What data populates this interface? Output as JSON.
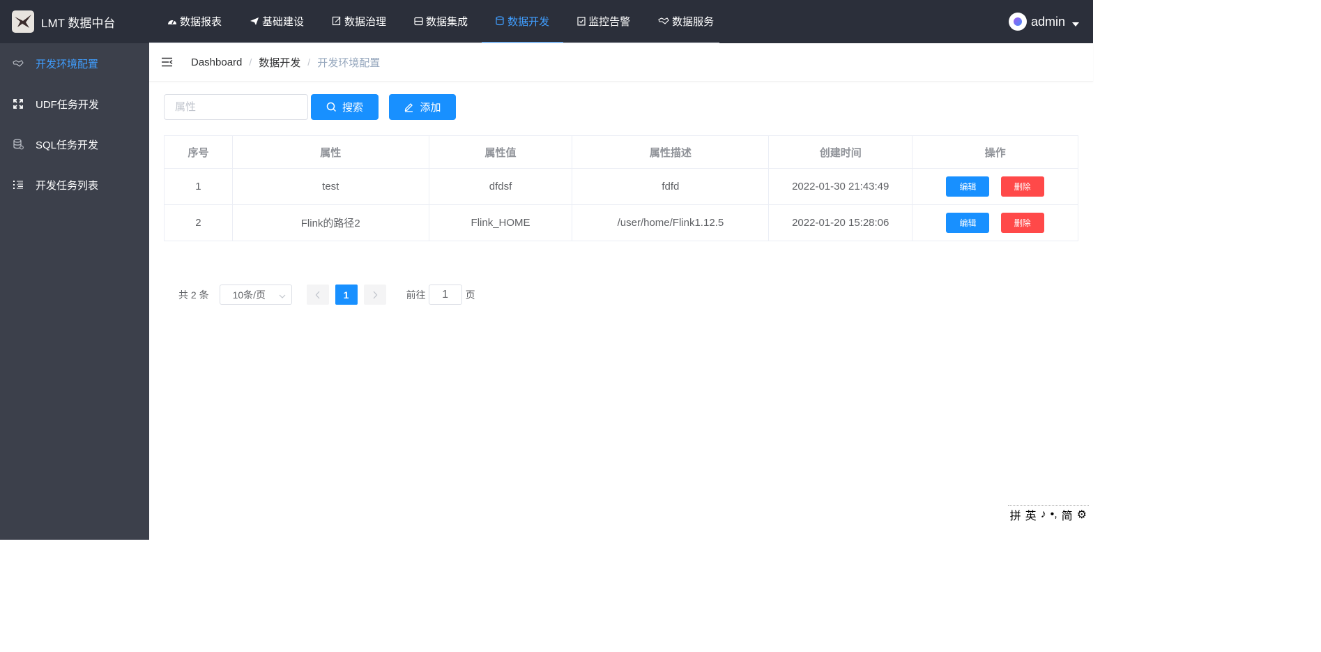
{
  "brand": {
    "title": "LMT 数据中台"
  },
  "topnav": [
    {
      "label": "数据报表",
      "icon": "dashboard-icon"
    },
    {
      "label": "基础建设",
      "icon": "paper-plane-icon"
    },
    {
      "label": "数据治理",
      "icon": "document-edit-icon"
    },
    {
      "label": "数据集成",
      "icon": "archive-icon"
    },
    {
      "label": "数据开发",
      "icon": "database-icon",
      "active": true
    },
    {
      "label": "监控告警",
      "icon": "clipboard-check-icon"
    },
    {
      "label": "数据服务",
      "icon": "handshake-icon"
    }
  ],
  "user": {
    "name": "admin"
  },
  "sidebar": [
    {
      "label": "开发环境配置",
      "icon": "handshake-icon",
      "active": true
    },
    {
      "label": "UDF任务开发",
      "icon": "fullscreen-icon"
    },
    {
      "label": "SQL任务开发",
      "icon": "database-icon"
    },
    {
      "label": "开发任务列表",
      "icon": "list-icon"
    }
  ],
  "breadcrumb": [
    "Dashboard",
    "数据开发",
    "开发环境配置"
  ],
  "toolbar": {
    "search_placeholder": "属性",
    "search_label": "搜索",
    "add_label": "添加"
  },
  "table": {
    "columns": [
      "序号",
      "属性",
      "属性值",
      "属性描述",
      "创建时间",
      "操作"
    ],
    "rows": [
      {
        "index": "1",
        "attr": "test",
        "value": "dfdsf",
        "desc": "fdfd",
        "created": "2022-01-30 21:43:49"
      },
      {
        "index": "2",
        "attr": "Flink的路径2",
        "value": "Flink_HOME",
        "desc": "/user/home/Flink1.12.5",
        "created": "2022-01-20 15:28:06"
      }
    ],
    "edit_label": "编辑",
    "delete_label": "删除"
  },
  "pagination": {
    "total_text": "共 2 条",
    "page_size": "10条/页",
    "current_page": "1",
    "jump_label": "前往",
    "jump_value": "1",
    "jump_suffix": "页"
  },
  "ime_toolbar": [
    "拼",
    "英",
    "♪",
    "•,",
    "简",
    "⚙"
  ],
  "colors": {
    "accent": "#1890ff",
    "danger": "#ff4949",
    "topbar": "#2b2f3a",
    "sidebar": "#3c404b"
  }
}
